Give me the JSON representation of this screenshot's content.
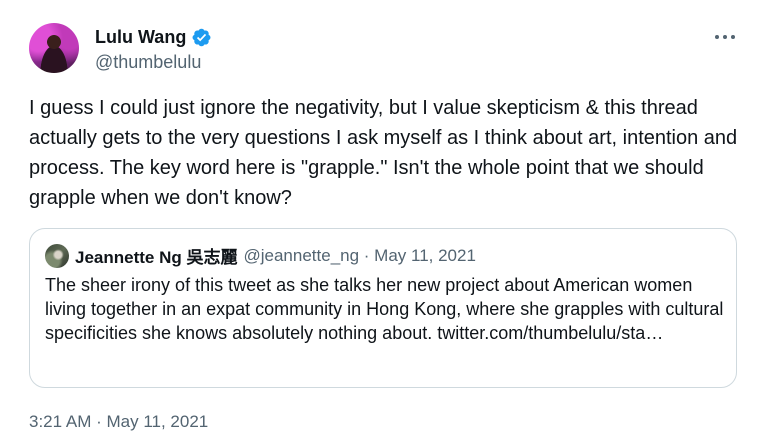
{
  "author": {
    "display_name": "Lulu Wang",
    "handle": "@thumbelulu",
    "verified_icon": "verified-badge-icon",
    "verified_color": "#1d9bf0"
  },
  "tweet": {
    "text": "I guess I could just ignore the negativity, but I value skepticism & this thread actually gets to the very questions I ask myself as I think about art, intention and process. The key word here is \"grapple.\" Isn't the whole point that we should grapple when we don't know?",
    "timestamp": "3:21 AM · May 11, 2021"
  },
  "quoted_tweet": {
    "display_name": "Jeannette Ng 吳志麗",
    "meta": "@jeannette_ng · May 11, 2021",
    "text": "The sheer irony of this tweet as she talks her new project about American women living together in an expat community in Hong Kong, where she grapples with cultural specificities she knows absolutely nothing about. twitter.com/thumbelulu/sta…"
  },
  "icons": {
    "more": "more-options-icon"
  }
}
